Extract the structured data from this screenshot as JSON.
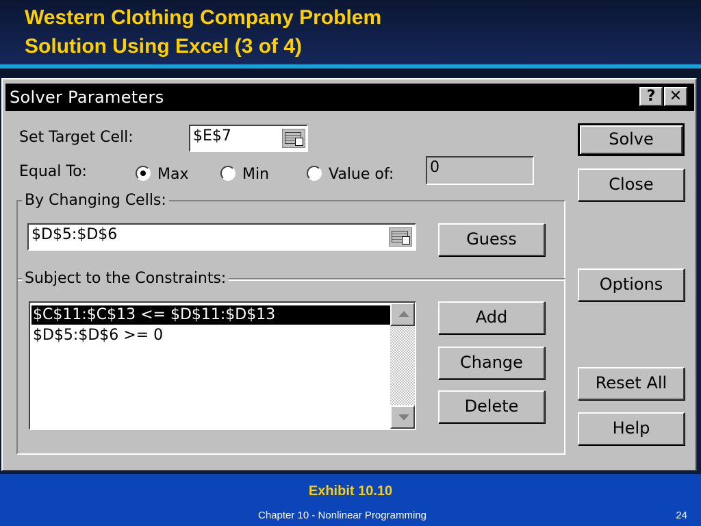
{
  "slide": {
    "title_line1": "Western Clothing Company Problem",
    "title_line2": "Solution Using Excel (3 of 4)",
    "exhibit": "Exhibit 10.10",
    "footer_chapter": "Chapter 10 - Nonlinear Programming",
    "page_number": "24"
  },
  "dialog": {
    "title": "Solver Parameters",
    "help_glyph": "?",
    "close_glyph": "✕",
    "set_target_label": "Set Target Cell:",
    "set_target_value": "$E$7",
    "equal_to_label": "Equal To:",
    "options": {
      "max": "Max",
      "min": "Min",
      "value_of": "Value of:"
    },
    "selected_option": "max",
    "value_of_field": "0",
    "changing_cells_label": "By Changing Cells:",
    "changing_cells_value": "$D$5:$D$6",
    "constraints_label": "Subject to the Constraints:",
    "constraints": [
      "$C$11:$C$13 <= $D$11:$D$13",
      "$D$5:$D$6 >= 0"
    ],
    "buttons": {
      "solve": "Solve",
      "close": "Close",
      "guess": "Guess",
      "options": "Options",
      "add": "Add",
      "change": "Change",
      "delete": "Delete",
      "reset_all": "Reset All",
      "help": "Help"
    }
  }
}
